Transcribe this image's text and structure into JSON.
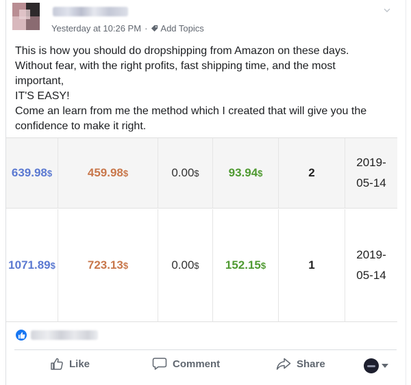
{
  "post": {
    "timestamp": "Yesterday at 10:26 PM",
    "separator": "·",
    "add_topics": "Add Topics",
    "body_lines": [
      "This is how you should do dropshipping from Amazon on these days.",
      "Without fear, with the right profits, fast shipping time, and the most",
      "important,",
      "IT'S EASY!",
      "Come an learn from me the method which I created that will give you the",
      "confidence to make it right."
    ]
  },
  "table": {
    "currency": "$",
    "rows": [
      {
        "sell": "639.98",
        "cost": "459.98",
        "fee": "0.00",
        "profit": "93.94",
        "qty": "2",
        "date_a": "2019-",
        "date_b": "05-14"
      },
      {
        "sell": "1071.89",
        "cost": "723.13",
        "fee": "0.00",
        "profit": "152.15",
        "qty": "1",
        "date_a": "2019-",
        "date_b": "05-14"
      }
    ]
  },
  "actions": {
    "like": "Like",
    "comment": "Comment",
    "share": "Share"
  },
  "icons": {
    "chevron": "chevron-down-icon",
    "tag": "tag-icon",
    "like_reaction": "thumbs-up-icon",
    "like": "like-outline-icon",
    "comment": "comment-bubble-icon",
    "share": "share-arrow-icon"
  },
  "colors": {
    "sell": "#5b79d1",
    "cost": "#c8774b",
    "profit": "#4f9a31",
    "facebook_blue": "#1877f2"
  }
}
